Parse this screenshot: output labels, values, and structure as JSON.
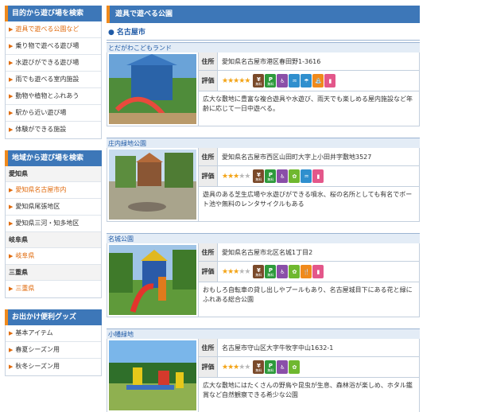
{
  "sidebar": {
    "sections": [
      {
        "title": "目的から遊び場を検索",
        "items": [
          {
            "label": "遊具で遊べる公園など",
            "active": true
          },
          {
            "label": "乗り物で遊べる遊び場",
            "active": false
          },
          {
            "label": "水遊びができる遊び場",
            "active": false
          },
          {
            "label": "雨でも遊べる室内施設",
            "active": false
          },
          {
            "label": "動物や植物とふれあう",
            "active": false
          },
          {
            "label": "駅から近い遊び場",
            "active": false
          },
          {
            "label": "体験ができる施設",
            "active": false
          }
        ]
      },
      {
        "title": "地域から遊び場を検索",
        "prefectures": [
          {
            "name": "愛知県",
            "items": [
              {
                "label": "愛知県名古屋市内",
                "active": true
              },
              {
                "label": "愛知県尾張地区",
                "active": false
              },
              {
                "label": "愛知県三河・知多地区",
                "active": false
              }
            ]
          },
          {
            "name": "岐阜県",
            "items": [
              {
                "label": "岐阜県",
                "active": true
              }
            ]
          },
          {
            "name": "三重県",
            "items": [
              {
                "label": "三重県",
                "active": true
              }
            ]
          }
        ]
      },
      {
        "title": "お出かけ便利グッズ",
        "items": [
          {
            "label": "基本アイテム",
            "active": false
          },
          {
            "label": "春夏シーズン用",
            "active": false
          },
          {
            "label": "秋冬シーズン用",
            "active": false
          }
        ]
      }
    ]
  },
  "main": {
    "title": "遊具で遊べる公園",
    "city": "名古屋市",
    "address_label": "住所",
    "rating_label": "評価",
    "parks": [
      {
        "name": "とだがわこどもランド",
        "address": "愛知県名古屋市港区春田野1-3616",
        "rating": 5,
        "icons": [
          [
            "brown",
            "¥",
            "無料"
          ],
          [
            "green",
            "P",
            "無料"
          ],
          [
            "purple",
            "♿",
            ""
          ],
          [
            "blue",
            "♒",
            ""
          ],
          [
            "blue",
            "☂",
            ""
          ],
          [
            "orange",
            "⛲",
            ""
          ],
          [
            "pink",
            "▮",
            ""
          ]
        ],
        "description": "広大な敷地に豊富な複合遊具や水遊び、雨天でも楽しめる屋内施設など年齢に応じて一日中遊べる。"
      },
      {
        "name": "庄内緑地公園",
        "address": "愛知県名古屋市西区山田町大字上小田井字敷地3527",
        "rating": 3,
        "icons": [
          [
            "brown",
            "¥",
            "無料"
          ],
          [
            "green",
            "P",
            "無料"
          ],
          [
            "purple",
            "♿",
            ""
          ],
          [
            "lgreen",
            "✿",
            ""
          ],
          [
            "blue",
            "♒",
            ""
          ],
          [
            "pink",
            "▮",
            ""
          ]
        ],
        "description": "遊具のある芝生広場や水遊びができる噴水、桜の名所としても有名でボート池や無料のレンタサイクルもある"
      },
      {
        "name": "名城公園",
        "address": "愛知県名古屋市北区名城1丁目2",
        "rating": 3,
        "icons": [
          [
            "brown",
            "¥",
            "無料"
          ],
          [
            "green",
            "P",
            "無料"
          ],
          [
            "purple",
            "♿",
            ""
          ],
          [
            "lgreen",
            "✿",
            ""
          ],
          [
            "orange",
            "🍴",
            ""
          ],
          [
            "pink",
            "▮",
            ""
          ]
        ],
        "description": "おもしろ自転車の貸し出しやプールもあり、名古屋城目下にある花と緑にふれある総合公園"
      },
      {
        "name": "小幡緑地",
        "address": "名古屋市守山区大字牛牧字中山1632-1",
        "rating": 3,
        "icons": [
          [
            "brown",
            "¥",
            "無料"
          ],
          [
            "green",
            "P",
            "無料"
          ],
          [
            "purple",
            "♿",
            ""
          ],
          [
            "lgreen",
            "✿",
            ""
          ]
        ],
        "description": "広大な敷地にはたくさんの野鳥や昆虫が生息、森林浴が楽しめ、ホタル鑑賞など自然観察できる希少な公園"
      }
    ]
  }
}
